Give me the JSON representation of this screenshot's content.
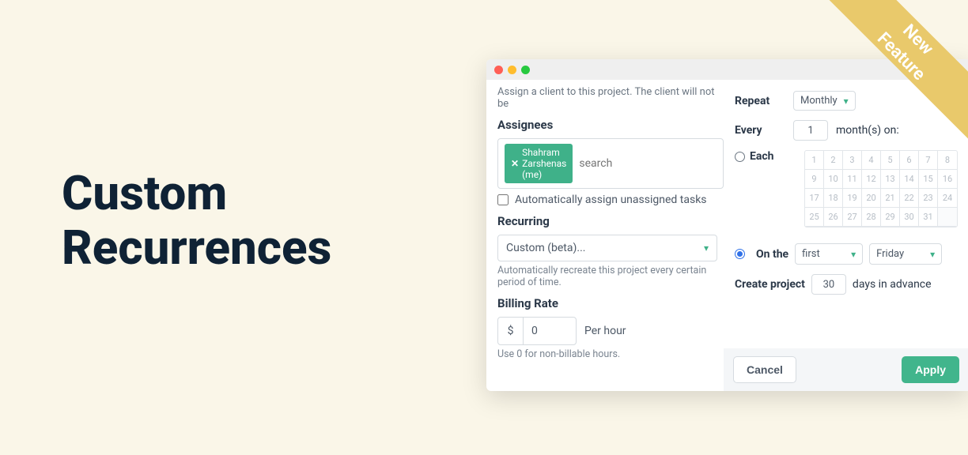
{
  "hero": {
    "line1": "Custom",
    "line2": "Recurrences"
  },
  "ribbon": {
    "line1": "New",
    "line2": "Feature"
  },
  "left": {
    "hint": "Assign a client to this project. The client will not be",
    "assignees_label": "Assignees",
    "chip": "Shahram Zarshenas (me)",
    "search_placeholder": "search",
    "auto_assign": "Automatically assign unassigned tasks",
    "recurring_label": "Recurring",
    "recurring_value": "Custom (beta)...",
    "recurring_hint": "Automatically recreate this project every certain period of time.",
    "billing_label": "Billing Rate",
    "billing_currency": "$",
    "billing_value": "0",
    "per_hour": "Per hour",
    "billing_hint": "Use 0 for non-billable hours."
  },
  "right": {
    "repeat_label": "Repeat",
    "repeat_value": "Monthly",
    "every_label": "Every",
    "every_value": "1",
    "every_suffix": "month(s) on:",
    "each_label": "Each",
    "days": [
      "1",
      "2",
      "3",
      "4",
      "5",
      "6",
      "7",
      "8",
      "9",
      "10",
      "11",
      "12",
      "13",
      "14",
      "15",
      "16",
      "17",
      "18",
      "19",
      "20",
      "21",
      "22",
      "23",
      "24",
      "25",
      "26",
      "27",
      "28",
      "29",
      "30",
      "31",
      ""
    ],
    "on_the_label": "On the",
    "ordinal": "first",
    "weekday": "Friday",
    "create_label": "Create project",
    "advance_value": "30",
    "advance_suffix": "days in advance",
    "cancel": "Cancel",
    "apply": "Apply"
  }
}
